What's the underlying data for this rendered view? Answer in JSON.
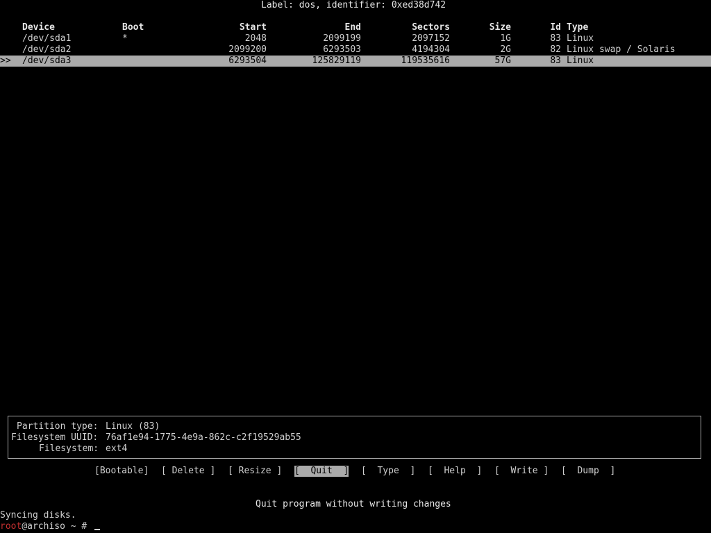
{
  "label_line": "Label: dos, identifier: 0xed38d742",
  "columns": {
    "device": "Device",
    "boot": "Boot",
    "start": "Start",
    "end": "End",
    "sectors": "Sectors",
    "size": "Size",
    "id": "Id",
    "type": "Type"
  },
  "partitions": [
    {
      "marker": "",
      "device": "/dev/sda1",
      "boot": "*",
      "start": "2048",
      "end": "2099199",
      "sectors": "2097152",
      "size": "1G",
      "id": "83",
      "type": "Linux"
    },
    {
      "marker": "",
      "device": "/dev/sda2",
      "boot": "",
      "start": "2099200",
      "end": "6293503",
      "sectors": "4194304",
      "size": "2G",
      "id": "82",
      "type": "Linux swap / Solaris"
    },
    {
      "marker": ">>",
      "device": "/dev/sda3",
      "boot": "",
      "start": "6293504",
      "end": "125829119",
      "sectors": "119535616",
      "size": "57G",
      "id": "83",
      "type": "Linux"
    }
  ],
  "info": {
    "partition_type_label": "Partition type:",
    "partition_type_value": "Linux (83)",
    "uuid_label": "Filesystem UUID:",
    "uuid_value": "76af1e94-1775-4e9a-862c-c2f19529ab55",
    "fs_label": "Filesystem:",
    "fs_value": "ext4"
  },
  "menu": {
    "bootable": "[Bootable]",
    "delete": "[ Delete ]",
    "resize": "[ Resize ]",
    "quit": "[  Quit  ]",
    "type": "[  Type  ]",
    "help": "[  Help  ]",
    "write": "[  Write ]",
    "dump": "[  Dump  ]"
  },
  "hint": "Quit program without writing changes",
  "terminal": {
    "line1": "Syncing disks.",
    "prompt_user": "root",
    "prompt_rest": "@archiso ~ # "
  },
  "colors": {
    "background": "#000000",
    "text": "#aaaaaa",
    "highlight": "#aaaaaa",
    "prompt_user": "#c53030"
  }
}
